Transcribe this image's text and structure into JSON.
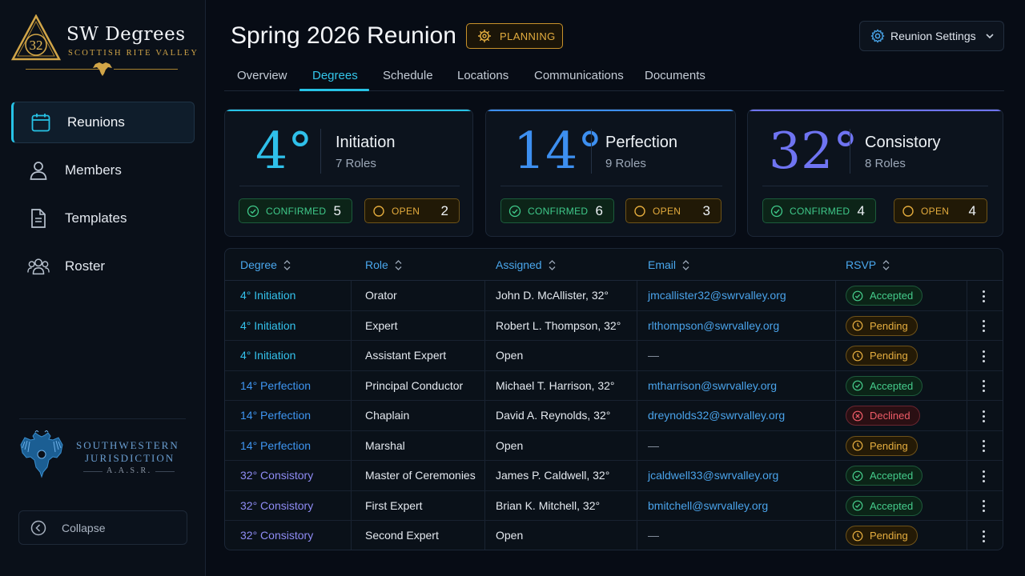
{
  "brand": {
    "emblem_number": "32",
    "title": "SW Degrees",
    "subtitle": "SCOTTISH RITE VALLEY",
    "footer_line1": "SOUTHWESTERN",
    "footer_line2": "JURISDICTION",
    "footer_line3": "A.A.S.R."
  },
  "sidebar": {
    "items": [
      {
        "label": "Reunions",
        "icon": "calendar-icon",
        "active": true
      },
      {
        "label": "Members",
        "icon": "user-icon",
        "active": false
      },
      {
        "label": "Templates",
        "icon": "document-icon",
        "active": false
      },
      {
        "label": "Roster",
        "icon": "group-icon",
        "active": false
      }
    ],
    "collapse_label": "Collapse"
  },
  "header": {
    "title": "Spring 2026 Reunion",
    "status": "PLANNING",
    "settings_label": "Reunion Settings"
  },
  "tabs": [
    {
      "label": "Overview",
      "active": false
    },
    {
      "label": "Degrees",
      "active": true
    },
    {
      "label": "Schedule",
      "active": false
    },
    {
      "label": "Locations",
      "active": false
    },
    {
      "label": "Communications",
      "active": false
    },
    {
      "label": "Documents",
      "active": false
    }
  ],
  "degree_cards": [
    {
      "degree": "4°",
      "name": "Initiation",
      "roles": "7 Roles",
      "confirmed_label": "CONFIRMED",
      "confirmed": "5",
      "open_label": "OPEN",
      "open": "2",
      "color": "#2fc0ea"
    },
    {
      "degree": "14°",
      "name": "Perfection",
      "roles": "9 Roles",
      "confirmed_label": "CONFIRMED",
      "confirmed": "6",
      "open_label": "OPEN",
      "open": "3",
      "color": "#3d8ff0"
    },
    {
      "degree": "32°",
      "name": "Consistory",
      "roles": "8 Roles",
      "confirmed_label": "CONFIRMED",
      "confirmed": "4",
      "open_label": "OPEN",
      "open": "4",
      "color": "#6f74f2"
    }
  ],
  "table": {
    "columns": [
      "Degree",
      "Role",
      "Assigned",
      "Email",
      "RSVP"
    ],
    "rows": [
      {
        "degree": "4° Initiation",
        "role": "Orator",
        "assigned": "John D. McAllister, 32°",
        "email": "jmcallister32@swrvalley.org",
        "rsvp": "Accepted"
      },
      {
        "degree": "4° Initiation",
        "role": "Expert",
        "assigned": "Robert L. Thompson, 32°",
        "email": "rlthompson@swrvalley.org",
        "rsvp": "Pending"
      },
      {
        "degree": "4° Initiation",
        "role": "Assistant Expert",
        "assigned": "Open",
        "email": "—",
        "rsvp": "Pending"
      },
      {
        "degree": "14° Perfection",
        "role": "Principal Conductor",
        "assigned": "Michael T. Harrison, 32°",
        "email": "mtharrison@swrvalley.org",
        "rsvp": "Accepted"
      },
      {
        "degree": "14° Perfection",
        "role": "Chaplain",
        "assigned": "David A. Reynolds, 32°",
        "email": "dreynolds32@swrvalley.org",
        "rsvp": "Declined"
      },
      {
        "degree": "14° Perfection",
        "role": "Marshal",
        "assigned": "Open",
        "email": "—",
        "rsvp": "Pending"
      },
      {
        "degree": "32° Consistory",
        "role": "Master of Ceremonies",
        "assigned": "James P. Caldwell, 32°",
        "email": "jcaldwell33@swrvalley.org",
        "rsvp": "Accepted"
      },
      {
        "degree": "32° Consistory",
        "role": "First Expert",
        "assigned": "Brian K. Mitchell, 32°",
        "email": "bmitchell@swrvalley.org",
        "rsvp": "Accepted"
      },
      {
        "degree": "32° Consistory",
        "role": "Second Expert",
        "assigned": "Open",
        "email": "—",
        "rsvp": "Pending"
      }
    ]
  },
  "colors": {
    "accent": "#27c3e6",
    "gold": "#d1a548",
    "accepted": "#45cd8c",
    "pending": "#e6ae3f",
    "declined": "#ef5c67"
  }
}
